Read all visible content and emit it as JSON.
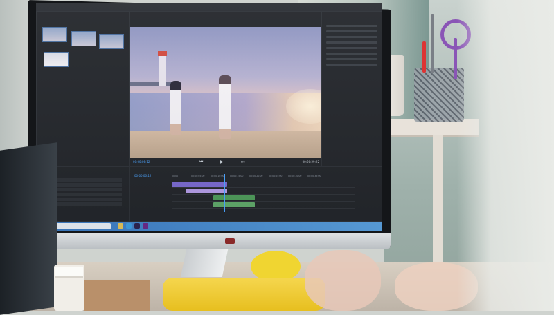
{
  "scene": {
    "description_objects": [
      "monitor",
      "desk",
      "pen-cup",
      "keyboard"
    ],
    "colors": {
      "accent_blue": "#4aa3ff",
      "taskbar_blue": "#3a78c0",
      "keyboard_yellow": "#f0d531",
      "scissor_purple": "#8a55b6"
    }
  },
  "editor": {
    "program_timecode_left": "00:00:06:12",
    "program_timecode_right": "00:00:29:22",
    "timeline_timecode": "00:00:06:12",
    "ruler_ticks": [
      "00:00",
      "00:00:05:00",
      "00:00:10:00",
      "00:00:15:00",
      "00:00:20:00",
      "00:00:25:00",
      "00:00:30:00",
      "00:00:35:00"
    ]
  },
  "icons": [
    "play-icon",
    "step-back-icon",
    "step-forward-icon",
    "windows-start-icon"
  ]
}
